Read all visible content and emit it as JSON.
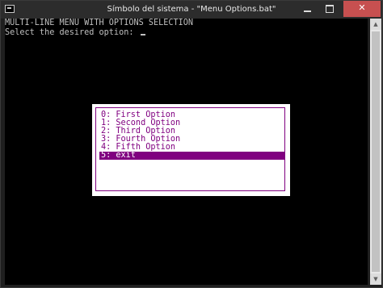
{
  "window": {
    "title": "Símbolo del sistema - \"Menu Options.bat\"",
    "minimize_label": "",
    "maximize_label": "",
    "close_label": "✕"
  },
  "console": {
    "header": "MULTI-LINE MENU WITH OPTIONS SELECTION",
    "prompt": "Select the desired option: "
  },
  "menu": {
    "items": [
      "0: First Option",
      "1: Second Option",
      "2: Third Option",
      "3: Fourth Option",
      "4: Fifth Option",
      "5: exit"
    ],
    "selected_index": 5
  },
  "colors": {
    "console_bg": "#000000",
    "console_text": "#c0c0c0",
    "menu_bg": "#ffffff",
    "menu_accent": "#800080",
    "close_button": "#c75050"
  },
  "icons": {
    "app": "console-icon",
    "scroll_up": "scroll-up-arrow-icon",
    "scroll_down": "scroll-down-arrow-icon"
  }
}
